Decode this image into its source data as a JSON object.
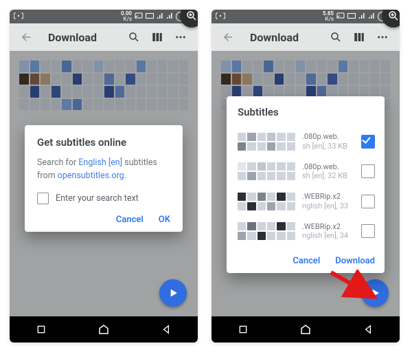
{
  "colors": {
    "accent": "#2f7af0",
    "link": "#3f7ee8",
    "fab": "#2f6de0",
    "arrow": "#e31818"
  },
  "statusbar": {
    "left_speed": {
      "value": "0.00",
      "unit": "K/s"
    },
    "right_speed": {
      "value": "5.85",
      "unit": "K/s"
    },
    "battery": "81"
  },
  "header": {
    "title": "Download",
    "search_icon": "search-icon",
    "view_icon": "columns-icon",
    "overflow_icon": "more-icon",
    "back_icon": "back-icon"
  },
  "navbar": {
    "recent": "square",
    "home": "pentagon",
    "back": "triangle"
  },
  "zoom_badge": "zoom-in-icon",
  "fab": {
    "icon": "play-icon"
  },
  "left": {
    "dialog": {
      "title": "Get subtitles online",
      "text_prefix": "Search for ",
      "lang_link": "English [en]",
      "text_mid": " subtitles from ",
      "source_link": "opensubtitles.org",
      "text_suffix": ".",
      "placeholder": "Enter your search text",
      "cancel": "Cancel",
      "ok": "OK"
    }
  },
  "right": {
    "dialog": {
      "title": "Subtitles",
      "cancel": "Cancel",
      "download": "Download",
      "items": [
        {
          "line1": ".080p.web.",
          "line2": "sh [en], 33 KB",
          "checked": true
        },
        {
          "line1": ".080p.web.",
          "line2": "sh [en], 32 KB",
          "checked": false
        },
        {
          "line1": ".WEBRip.x2",
          "line2": "nglish [en], 33",
          "checked": false
        },
        {
          "line1": ".WEBRip.x2",
          "line2": "nglish [en], 34",
          "checked": false
        }
      ]
    }
  }
}
